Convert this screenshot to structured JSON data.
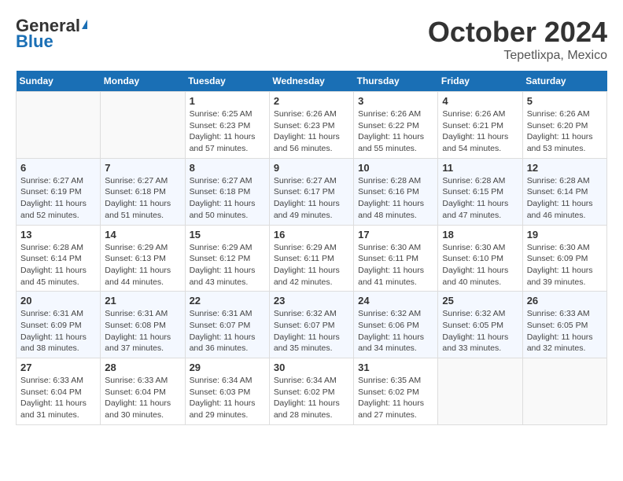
{
  "logo": {
    "general": "General",
    "blue": "Blue"
  },
  "title": {
    "month": "October 2024",
    "location": "Tepetlixpa, Mexico"
  },
  "weekdays": [
    "Sunday",
    "Monday",
    "Tuesday",
    "Wednesday",
    "Thursday",
    "Friday",
    "Saturday"
  ],
  "weeks": [
    [
      {
        "day": "",
        "info": ""
      },
      {
        "day": "",
        "info": ""
      },
      {
        "day": "1",
        "info": "Sunrise: 6:25 AM\nSunset: 6:23 PM\nDaylight: 11 hours and 57 minutes."
      },
      {
        "day": "2",
        "info": "Sunrise: 6:26 AM\nSunset: 6:23 PM\nDaylight: 11 hours and 56 minutes."
      },
      {
        "day": "3",
        "info": "Sunrise: 6:26 AM\nSunset: 6:22 PM\nDaylight: 11 hours and 55 minutes."
      },
      {
        "day": "4",
        "info": "Sunrise: 6:26 AM\nSunset: 6:21 PM\nDaylight: 11 hours and 54 minutes."
      },
      {
        "day": "5",
        "info": "Sunrise: 6:26 AM\nSunset: 6:20 PM\nDaylight: 11 hours and 53 minutes."
      }
    ],
    [
      {
        "day": "6",
        "info": "Sunrise: 6:27 AM\nSunset: 6:19 PM\nDaylight: 11 hours and 52 minutes."
      },
      {
        "day": "7",
        "info": "Sunrise: 6:27 AM\nSunset: 6:18 PM\nDaylight: 11 hours and 51 minutes."
      },
      {
        "day": "8",
        "info": "Sunrise: 6:27 AM\nSunset: 6:18 PM\nDaylight: 11 hours and 50 minutes."
      },
      {
        "day": "9",
        "info": "Sunrise: 6:27 AM\nSunset: 6:17 PM\nDaylight: 11 hours and 49 minutes."
      },
      {
        "day": "10",
        "info": "Sunrise: 6:28 AM\nSunset: 6:16 PM\nDaylight: 11 hours and 48 minutes."
      },
      {
        "day": "11",
        "info": "Sunrise: 6:28 AM\nSunset: 6:15 PM\nDaylight: 11 hours and 47 minutes."
      },
      {
        "day": "12",
        "info": "Sunrise: 6:28 AM\nSunset: 6:14 PM\nDaylight: 11 hours and 46 minutes."
      }
    ],
    [
      {
        "day": "13",
        "info": "Sunrise: 6:28 AM\nSunset: 6:14 PM\nDaylight: 11 hours and 45 minutes."
      },
      {
        "day": "14",
        "info": "Sunrise: 6:29 AM\nSunset: 6:13 PM\nDaylight: 11 hours and 44 minutes."
      },
      {
        "day": "15",
        "info": "Sunrise: 6:29 AM\nSunset: 6:12 PM\nDaylight: 11 hours and 43 minutes."
      },
      {
        "day": "16",
        "info": "Sunrise: 6:29 AM\nSunset: 6:11 PM\nDaylight: 11 hours and 42 minutes."
      },
      {
        "day": "17",
        "info": "Sunrise: 6:30 AM\nSunset: 6:11 PM\nDaylight: 11 hours and 41 minutes."
      },
      {
        "day": "18",
        "info": "Sunrise: 6:30 AM\nSunset: 6:10 PM\nDaylight: 11 hours and 40 minutes."
      },
      {
        "day": "19",
        "info": "Sunrise: 6:30 AM\nSunset: 6:09 PM\nDaylight: 11 hours and 39 minutes."
      }
    ],
    [
      {
        "day": "20",
        "info": "Sunrise: 6:31 AM\nSunset: 6:09 PM\nDaylight: 11 hours and 38 minutes."
      },
      {
        "day": "21",
        "info": "Sunrise: 6:31 AM\nSunset: 6:08 PM\nDaylight: 11 hours and 37 minutes."
      },
      {
        "day": "22",
        "info": "Sunrise: 6:31 AM\nSunset: 6:07 PM\nDaylight: 11 hours and 36 minutes."
      },
      {
        "day": "23",
        "info": "Sunrise: 6:32 AM\nSunset: 6:07 PM\nDaylight: 11 hours and 35 minutes."
      },
      {
        "day": "24",
        "info": "Sunrise: 6:32 AM\nSunset: 6:06 PM\nDaylight: 11 hours and 34 minutes."
      },
      {
        "day": "25",
        "info": "Sunrise: 6:32 AM\nSunset: 6:05 PM\nDaylight: 11 hours and 33 minutes."
      },
      {
        "day": "26",
        "info": "Sunrise: 6:33 AM\nSunset: 6:05 PM\nDaylight: 11 hours and 32 minutes."
      }
    ],
    [
      {
        "day": "27",
        "info": "Sunrise: 6:33 AM\nSunset: 6:04 PM\nDaylight: 11 hours and 31 minutes."
      },
      {
        "day": "28",
        "info": "Sunrise: 6:33 AM\nSunset: 6:04 PM\nDaylight: 11 hours and 30 minutes."
      },
      {
        "day": "29",
        "info": "Sunrise: 6:34 AM\nSunset: 6:03 PM\nDaylight: 11 hours and 29 minutes."
      },
      {
        "day": "30",
        "info": "Sunrise: 6:34 AM\nSunset: 6:02 PM\nDaylight: 11 hours and 28 minutes."
      },
      {
        "day": "31",
        "info": "Sunrise: 6:35 AM\nSunset: 6:02 PM\nDaylight: 11 hours and 27 minutes."
      },
      {
        "day": "",
        "info": ""
      },
      {
        "day": "",
        "info": ""
      }
    ]
  ]
}
